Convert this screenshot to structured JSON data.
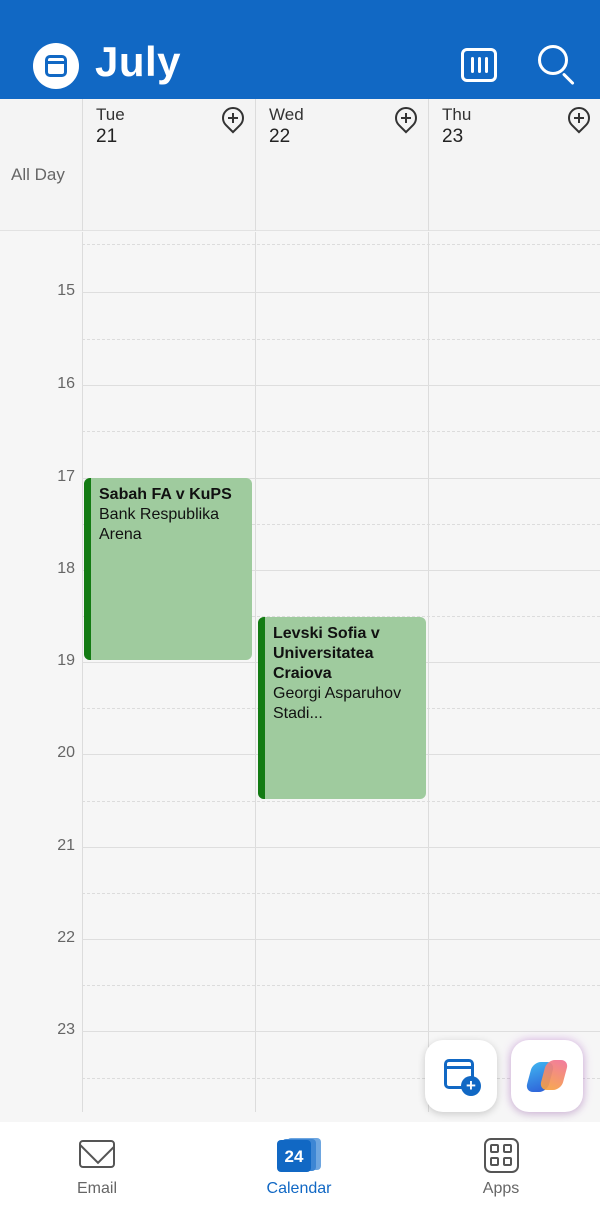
{
  "header": {
    "month": "July"
  },
  "all_day_label": "All Day",
  "days": [
    {
      "name": "Tue",
      "num": "21"
    },
    {
      "name": "Wed",
      "num": "22"
    },
    {
      "name": "Thu",
      "num": "23"
    }
  ],
  "hours": [
    "15",
    "16",
    "17",
    "18",
    "19",
    "20",
    "21",
    "22",
    "23"
  ],
  "events": [
    {
      "title": "Sabah FA v KuPS",
      "location": "Bank Respublika Arena",
      "day": "Tue 21",
      "start": "17:00",
      "end": "19:00",
      "color": "#9fcb9e",
      "accent": "#137b13"
    },
    {
      "title": "Levski Sofia v Universitatea Craiova",
      "location": "Georgi Asparuhov Stadi...",
      "day": "Wed 22",
      "start": "18:30",
      "end": "20:30",
      "color": "#9fcb9e",
      "accent": "#137b13"
    }
  ],
  "nav": {
    "email": "Email",
    "calendar": "Calendar",
    "calendar_badge": "24",
    "apps": "Apps"
  },
  "colors": {
    "brand": "#1168c4"
  }
}
